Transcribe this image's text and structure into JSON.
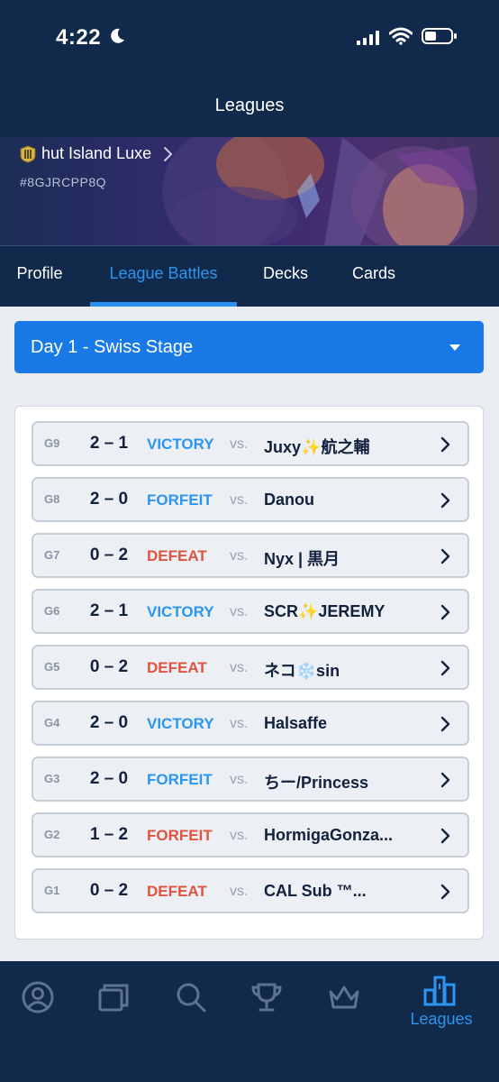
{
  "status_bar": {
    "time": "4:22"
  },
  "header": {
    "title": "Leagues"
  },
  "profile": {
    "name": "hut Island Luxe",
    "tag": "#8GJRCPP8Q"
  },
  "tabs": [
    {
      "label": "Profile",
      "active": false
    },
    {
      "label": "League Battles",
      "active": true
    },
    {
      "label": "Decks",
      "active": false
    },
    {
      "label": "Cards",
      "active": false
    }
  ],
  "stage_select": {
    "value": "Day 1 - Swiss Stage"
  },
  "colors": {
    "navy": "#11294a",
    "accent_blue": "#2b95f0",
    "victory": "#2b95f0",
    "defeat": "#e0533f"
  },
  "battles": [
    {
      "game": "G9",
      "score": "2 – 1",
      "result": "VICTORY",
      "result_color": "#2b95f0",
      "vs": "vs.",
      "opponent": "Juxy✨航之輔"
    },
    {
      "game": "G8",
      "score": "2 – 0",
      "result": "FORFEIT",
      "result_color": "#2b95f0",
      "vs": "vs.",
      "opponent": "Danou"
    },
    {
      "game": "G7",
      "score": "0 – 2",
      "result": "DEFEAT",
      "result_color": "#e0533f",
      "vs": "vs.",
      "opponent": "Nyx | 黒月"
    },
    {
      "game": "G6",
      "score": "2 – 1",
      "result": "VICTORY",
      "result_color": "#2b95f0",
      "vs": "vs.",
      "opponent": "SCR✨JEREMY"
    },
    {
      "game": "G5",
      "score": "0 – 2",
      "result": "DEFEAT",
      "result_color": "#e0533f",
      "vs": "vs.",
      "opponent": "ネコ❄️sin"
    },
    {
      "game": "G4",
      "score": "2 – 0",
      "result": "VICTORY",
      "result_color": "#2b95f0",
      "vs": "vs.",
      "opponent": "Halsaffe"
    },
    {
      "game": "G3",
      "score": "2 – 0",
      "result": "FORFEIT",
      "result_color": "#2b95f0",
      "vs": "vs.",
      "opponent": "ちー/Princess"
    },
    {
      "game": "G2",
      "score": "1 – 2",
      "result": "FORFEIT",
      "result_color": "#e0533f",
      "vs": "vs.",
      "opponent": "HormigaGonza..."
    },
    {
      "game": "G1",
      "score": "0 – 2",
      "result": "DEFEAT",
      "result_color": "#e0533f",
      "vs": "vs.",
      "opponent": "CAL Sub ™..."
    }
  ],
  "bottom_nav": [
    {
      "icon": "profile-icon",
      "label": ""
    },
    {
      "icon": "cards-icon",
      "label": ""
    },
    {
      "icon": "search-icon",
      "label": ""
    },
    {
      "icon": "trophy-icon",
      "label": ""
    },
    {
      "icon": "crown-icon",
      "label": ""
    },
    {
      "icon": "leagues-icon",
      "label": "Leagues",
      "active": true
    }
  ]
}
